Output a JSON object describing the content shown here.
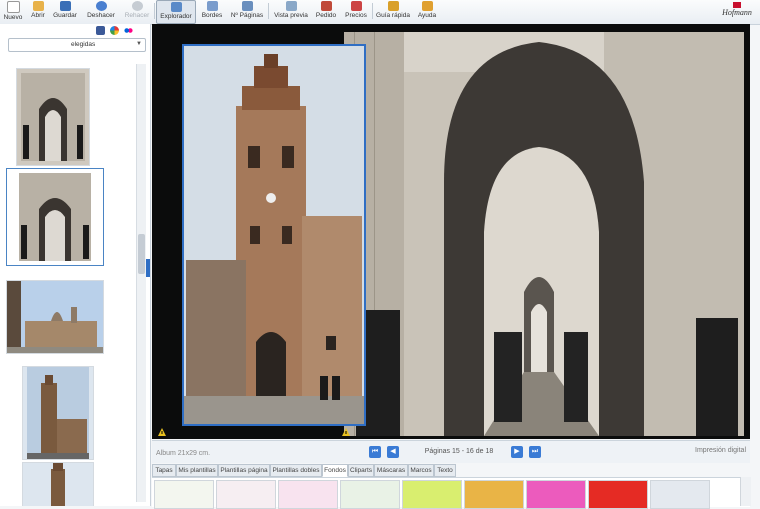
{
  "toolbar": {
    "buttons": [
      {
        "label": "Nuevo",
        "icon": "new-file-icon",
        "color": "#ffffff"
      },
      {
        "label": "Abrir",
        "icon": "open-folder-icon",
        "color": "#e8b24a"
      },
      {
        "label": "Guardar",
        "icon": "save-icon",
        "color": "#3a6fb7"
      },
      {
        "label": "Deshacer",
        "icon": "undo-icon",
        "color": "#4a7fd0"
      },
      {
        "label": "Rehacer",
        "icon": "redo-icon",
        "color": "#c6ccd3"
      },
      {
        "label": "Explorador",
        "icon": "explorer-icon",
        "color": "#5a8ac8"
      },
      {
        "label": "Bordes",
        "icon": "borders-icon",
        "color": "#7a9ccc"
      },
      {
        "label": "Nº Páginas",
        "icon": "pages-icon",
        "color": "#6a8fbe"
      },
      {
        "label": "Vista previa",
        "icon": "preview-icon",
        "color": "#8aa8c8"
      },
      {
        "label": "Pedido",
        "icon": "order-icon",
        "color": "#c04a3a"
      },
      {
        "label": "Precios",
        "icon": "prices-icon",
        "color": "#c44"
      },
      {
        "label": "Guía rápida",
        "icon": "quick-guide-icon",
        "color": "#d9a02a"
      },
      {
        "label": "Ayuda",
        "icon": "help-icon",
        "color": "#e0a030"
      }
    ],
    "logo": "Hofmann"
  },
  "sidebar": {
    "filter_value": "elegidas",
    "social_icons": [
      "facebook-icon",
      "picasa-icon",
      "flickr-icon"
    ]
  },
  "status": {
    "album": "Album 21x29 cm.",
    "pages": "Páginas 15 - 16 de 18",
    "print_type": "Impresión digital"
  },
  "tabs": [
    {
      "label": "Tapas"
    },
    {
      "label": "Mis plantillas"
    },
    {
      "label": "Plantillas página"
    },
    {
      "label": "Plantillas dobles"
    },
    {
      "label": "Fondos",
      "active": true
    },
    {
      "label": "Cliparts"
    },
    {
      "label": "Máscaras"
    },
    {
      "label": "Marcos"
    },
    {
      "label": "Texto"
    }
  ],
  "swatches": [
    "#f3f6ef",
    "#f6eef2",
    "#f8e3ef",
    "#e9f2e6",
    "#d9ee6f",
    "#e9b446",
    "#ec5bbd",
    "#e52b24",
    "#e4e9ef"
  ],
  "colors": {
    "accent": "#2f6ec4",
    "canvas": "#0b0c0c"
  }
}
